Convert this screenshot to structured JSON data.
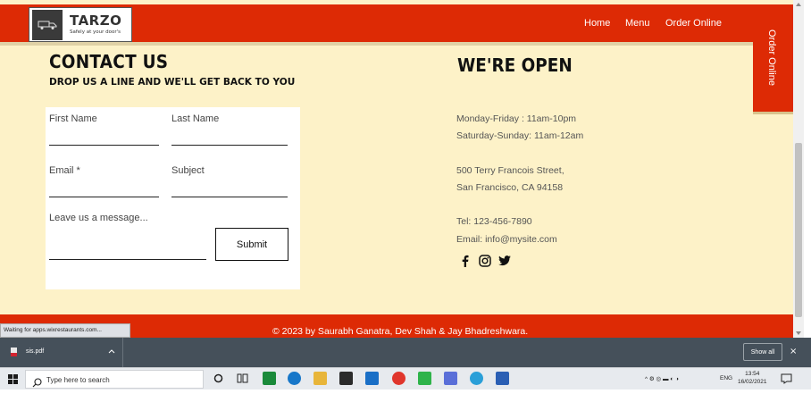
{
  "header": {
    "logo_name": "TARZO",
    "logo_tagline": "Safely at your door's",
    "nav": [
      "Home",
      "Menu",
      "Order Online"
    ],
    "side_tab": "Order Online"
  },
  "contact": {
    "title": "CONTACT US",
    "subtitle": "DROP US A LINE AND WE'LL GET BACK TO YOU",
    "fields": {
      "first_name": "First Name",
      "last_name": "Last Name",
      "email": "Email *",
      "subject": "Subject",
      "message": "Leave us a message..."
    },
    "submit_label": "Submit"
  },
  "open": {
    "title": "WE'RE OPEN",
    "hours_weekday": "Monday-Friday : 11am-10pm",
    "hours_weekend": "Saturday-Sunday: 11am-12am",
    "address_line1": "500 Terry Francois Street,",
    "address_line2": "San Francisco, CA 94158",
    "tel": "Tel: 123-456-7890",
    "email": "Email: info@mysite.com",
    "socials": [
      "facebook-icon",
      "instagram-icon",
      "twitter-icon"
    ]
  },
  "footer": {
    "text": "© 2023 by Saurabh Ganatra, Dev Shah & Jay Bhadreshwara."
  },
  "browser": {
    "status": "Waiting for apps.wixrestaurants.com...",
    "download_file": "sis.pdf",
    "show_all": "Show all",
    "close": "×"
  },
  "taskbar": {
    "search_placeholder": "Type here to search",
    "lang": "ENG",
    "time": "13:54",
    "date": "16/02/2021"
  },
  "colors": {
    "brand_red": "#dd2a05",
    "cream": "#fdf2c8",
    "download_bar": "#45505a"
  }
}
